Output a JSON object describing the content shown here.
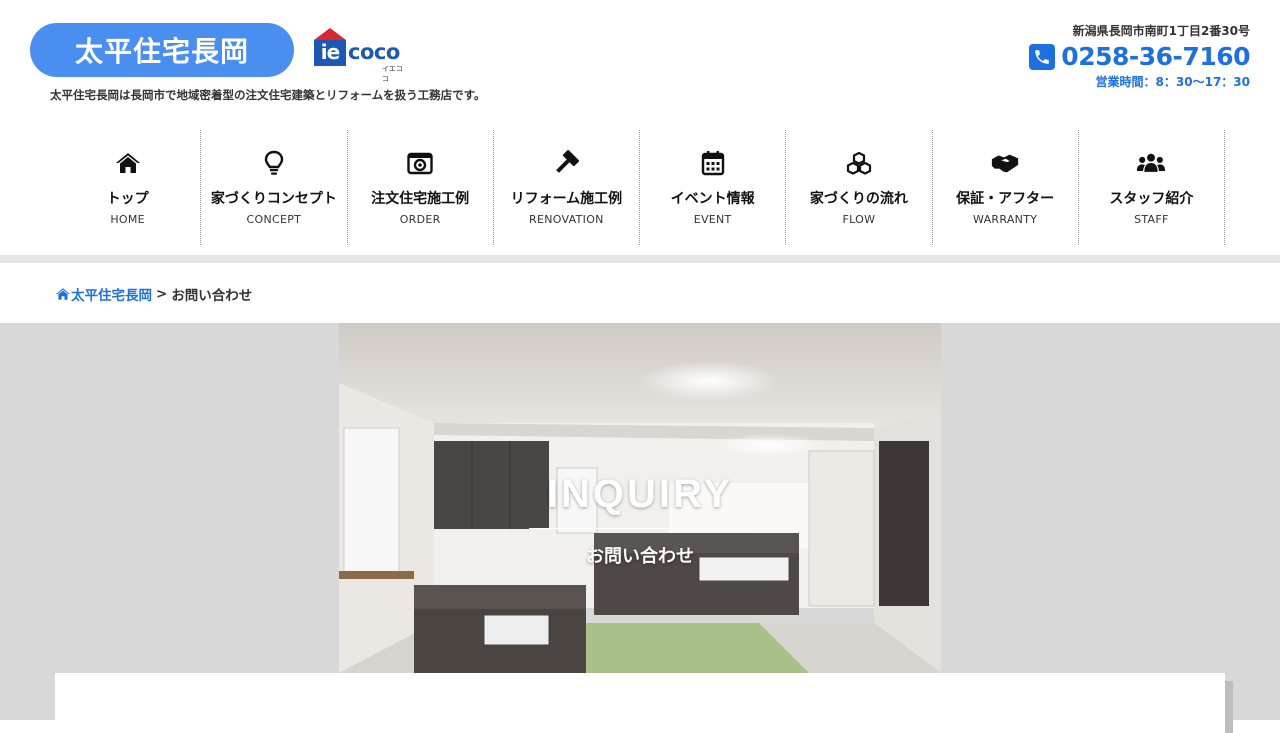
{
  "header": {
    "logo_text": "太平住宅長岡",
    "partner_logo": {
      "ie": "ie",
      "coco": "coco",
      "reading": "イエココ"
    },
    "tagline": "太平住宅長岡は長岡市で地域密着型の注文住宅建築とリフォームを扱う工務店です。",
    "address": "新潟県長岡市南町1丁目2番30号",
    "phone": "0258-36-7160",
    "hours": "営業時間：8：30～17：30"
  },
  "nav": {
    "items": [
      {
        "label": "トップ",
        "sub": "HOME",
        "icon": "home-icon"
      },
      {
        "label": "家づくりコンセプト",
        "sub": "CONCEPT",
        "icon": "lightbulb-icon"
      },
      {
        "label": "注文住宅施工例",
        "sub": "ORDER",
        "icon": "camera-icon"
      },
      {
        "label": "リフォーム施工例",
        "sub": "RENOVATION",
        "icon": "hammer-icon"
      },
      {
        "label": "イベント情報",
        "sub": "EVENT",
        "icon": "calendar-icon"
      },
      {
        "label": "家づくりの流れ",
        "sub": "FLOW",
        "icon": "cubes-icon"
      },
      {
        "label": "保証・アフター",
        "sub": "WARRANTY",
        "icon": "handshake-icon"
      },
      {
        "label": "スタッフ紹介",
        "sub": "STAFF",
        "icon": "users-icon"
      }
    ]
  },
  "breadcrumb": {
    "home": "太平住宅長岡",
    "separator": ">",
    "current": "お問い合わせ"
  },
  "hero": {
    "title": "INQUIRY",
    "subtitle": "お問い合わせ"
  },
  "colors": {
    "accent": "#1e6fe0",
    "logo_pill": "#4a8ef0",
    "hero_bg": "#d8d8d8"
  }
}
